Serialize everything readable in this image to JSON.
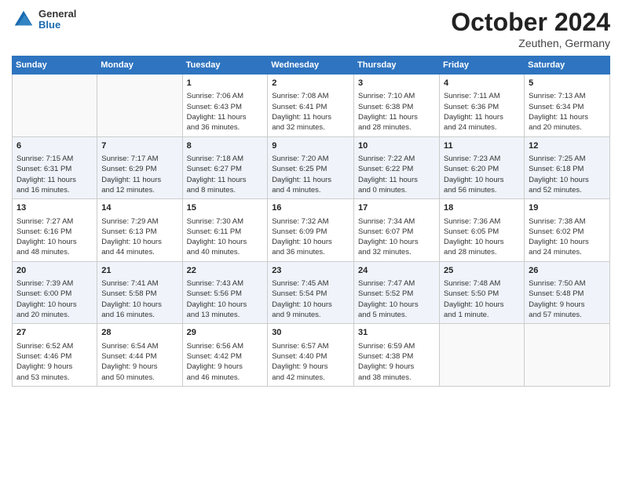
{
  "header": {
    "logo_general": "General",
    "logo_blue": "Blue",
    "title": "October 2024",
    "location": "Zeuthen, Germany"
  },
  "weekdays": [
    "Sunday",
    "Monday",
    "Tuesday",
    "Wednesday",
    "Thursday",
    "Friday",
    "Saturday"
  ],
  "weeks": [
    [
      {
        "day": "",
        "info": ""
      },
      {
        "day": "",
        "info": ""
      },
      {
        "day": "1",
        "info": "Sunrise: 7:06 AM\nSunset: 6:43 PM\nDaylight: 11 hours\nand 36 minutes."
      },
      {
        "day": "2",
        "info": "Sunrise: 7:08 AM\nSunset: 6:41 PM\nDaylight: 11 hours\nand 32 minutes."
      },
      {
        "day": "3",
        "info": "Sunrise: 7:10 AM\nSunset: 6:38 PM\nDaylight: 11 hours\nand 28 minutes."
      },
      {
        "day": "4",
        "info": "Sunrise: 7:11 AM\nSunset: 6:36 PM\nDaylight: 11 hours\nand 24 minutes."
      },
      {
        "day": "5",
        "info": "Sunrise: 7:13 AM\nSunset: 6:34 PM\nDaylight: 11 hours\nand 20 minutes."
      }
    ],
    [
      {
        "day": "6",
        "info": "Sunrise: 7:15 AM\nSunset: 6:31 PM\nDaylight: 11 hours\nand 16 minutes."
      },
      {
        "day": "7",
        "info": "Sunrise: 7:17 AM\nSunset: 6:29 PM\nDaylight: 11 hours\nand 12 minutes."
      },
      {
        "day": "8",
        "info": "Sunrise: 7:18 AM\nSunset: 6:27 PM\nDaylight: 11 hours\nand 8 minutes."
      },
      {
        "day": "9",
        "info": "Sunrise: 7:20 AM\nSunset: 6:25 PM\nDaylight: 11 hours\nand 4 minutes."
      },
      {
        "day": "10",
        "info": "Sunrise: 7:22 AM\nSunset: 6:22 PM\nDaylight: 11 hours\nand 0 minutes."
      },
      {
        "day": "11",
        "info": "Sunrise: 7:23 AM\nSunset: 6:20 PM\nDaylight: 10 hours\nand 56 minutes."
      },
      {
        "day": "12",
        "info": "Sunrise: 7:25 AM\nSunset: 6:18 PM\nDaylight: 10 hours\nand 52 minutes."
      }
    ],
    [
      {
        "day": "13",
        "info": "Sunrise: 7:27 AM\nSunset: 6:16 PM\nDaylight: 10 hours\nand 48 minutes."
      },
      {
        "day": "14",
        "info": "Sunrise: 7:29 AM\nSunset: 6:13 PM\nDaylight: 10 hours\nand 44 minutes."
      },
      {
        "day": "15",
        "info": "Sunrise: 7:30 AM\nSunset: 6:11 PM\nDaylight: 10 hours\nand 40 minutes."
      },
      {
        "day": "16",
        "info": "Sunrise: 7:32 AM\nSunset: 6:09 PM\nDaylight: 10 hours\nand 36 minutes."
      },
      {
        "day": "17",
        "info": "Sunrise: 7:34 AM\nSunset: 6:07 PM\nDaylight: 10 hours\nand 32 minutes."
      },
      {
        "day": "18",
        "info": "Sunrise: 7:36 AM\nSunset: 6:05 PM\nDaylight: 10 hours\nand 28 minutes."
      },
      {
        "day": "19",
        "info": "Sunrise: 7:38 AM\nSunset: 6:02 PM\nDaylight: 10 hours\nand 24 minutes."
      }
    ],
    [
      {
        "day": "20",
        "info": "Sunrise: 7:39 AM\nSunset: 6:00 PM\nDaylight: 10 hours\nand 20 minutes."
      },
      {
        "day": "21",
        "info": "Sunrise: 7:41 AM\nSunset: 5:58 PM\nDaylight: 10 hours\nand 16 minutes."
      },
      {
        "day": "22",
        "info": "Sunrise: 7:43 AM\nSunset: 5:56 PM\nDaylight: 10 hours\nand 13 minutes."
      },
      {
        "day": "23",
        "info": "Sunrise: 7:45 AM\nSunset: 5:54 PM\nDaylight: 10 hours\nand 9 minutes."
      },
      {
        "day": "24",
        "info": "Sunrise: 7:47 AM\nSunset: 5:52 PM\nDaylight: 10 hours\nand 5 minutes."
      },
      {
        "day": "25",
        "info": "Sunrise: 7:48 AM\nSunset: 5:50 PM\nDaylight: 10 hours\nand 1 minute."
      },
      {
        "day": "26",
        "info": "Sunrise: 7:50 AM\nSunset: 5:48 PM\nDaylight: 9 hours\nand 57 minutes."
      }
    ],
    [
      {
        "day": "27",
        "info": "Sunrise: 6:52 AM\nSunset: 4:46 PM\nDaylight: 9 hours\nand 53 minutes."
      },
      {
        "day": "28",
        "info": "Sunrise: 6:54 AM\nSunset: 4:44 PM\nDaylight: 9 hours\nand 50 minutes."
      },
      {
        "day": "29",
        "info": "Sunrise: 6:56 AM\nSunset: 4:42 PM\nDaylight: 9 hours\nand 46 minutes."
      },
      {
        "day": "30",
        "info": "Sunrise: 6:57 AM\nSunset: 4:40 PM\nDaylight: 9 hours\nand 42 minutes."
      },
      {
        "day": "31",
        "info": "Sunrise: 6:59 AM\nSunset: 4:38 PM\nDaylight: 9 hours\nand 38 minutes."
      },
      {
        "day": "",
        "info": ""
      },
      {
        "day": "",
        "info": ""
      }
    ]
  ]
}
